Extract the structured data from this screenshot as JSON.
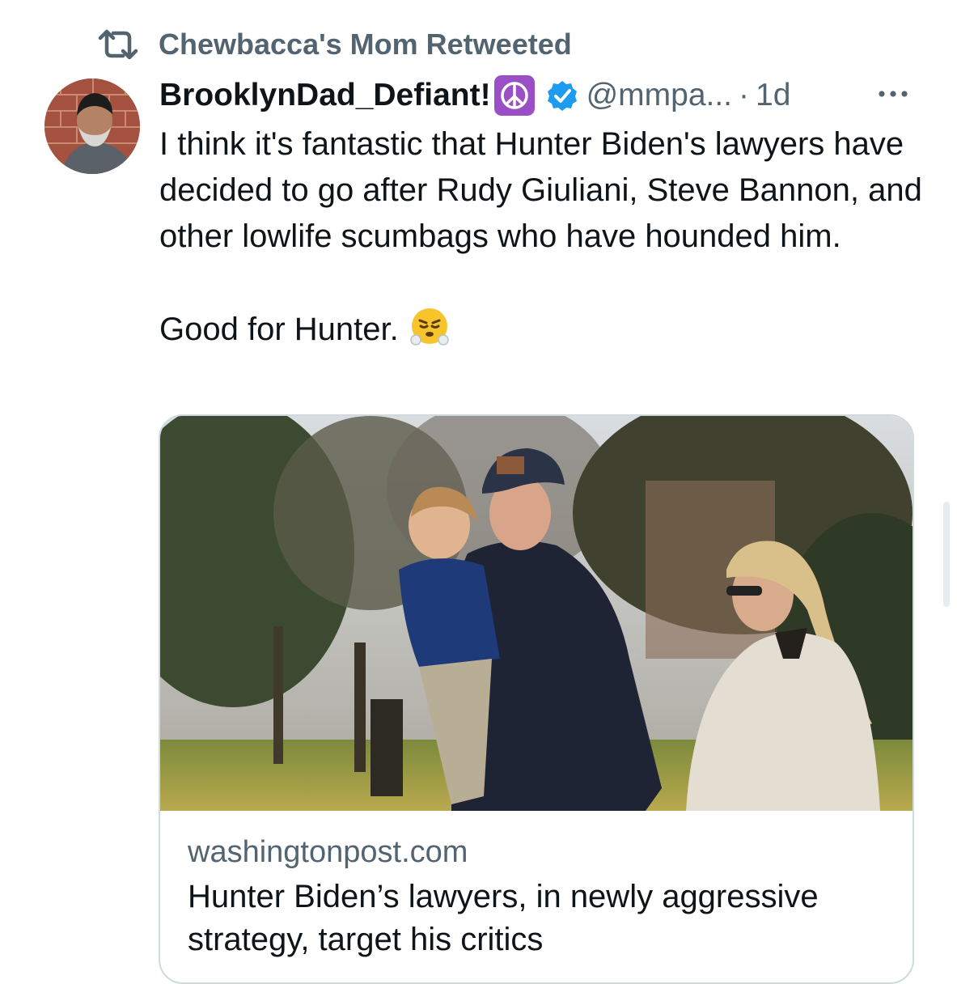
{
  "retweet": {
    "icon": "retweet-icon",
    "label": "Chewbacca's Mom Retweeted"
  },
  "tweet": {
    "avatar_icon": "user-avatar",
    "display_name": "BrooklynDad_Defiant!",
    "name_badge_icon": "peace-symbol-icon",
    "verified_icon": "verified-badge-icon",
    "handle": "@mmpa...",
    "separator": "·",
    "time": "1d",
    "more_icon": "more-options-icon",
    "text": "I think it's fantastic that Hunter Biden's lawyers have decided to go after Rudy Giuliani, Steve Bannon, and other lowlife scumbags who have hounded him.\n\nGood for Hunter.",
    "text_emoji_icon": "face-with-steam-emoji-icon"
  },
  "link_card": {
    "image": "article-photo",
    "domain": "washingtonpost.com",
    "title": "Hunter Biden’s lawyers, in newly aggressive strategy, target his critics"
  },
  "colors": {
    "text_primary": "#0f1419",
    "text_secondary": "#536471",
    "verified_blue": "#1d9bf0",
    "card_border": "#cfd9de",
    "badge_purple": "#9a4fc6"
  }
}
